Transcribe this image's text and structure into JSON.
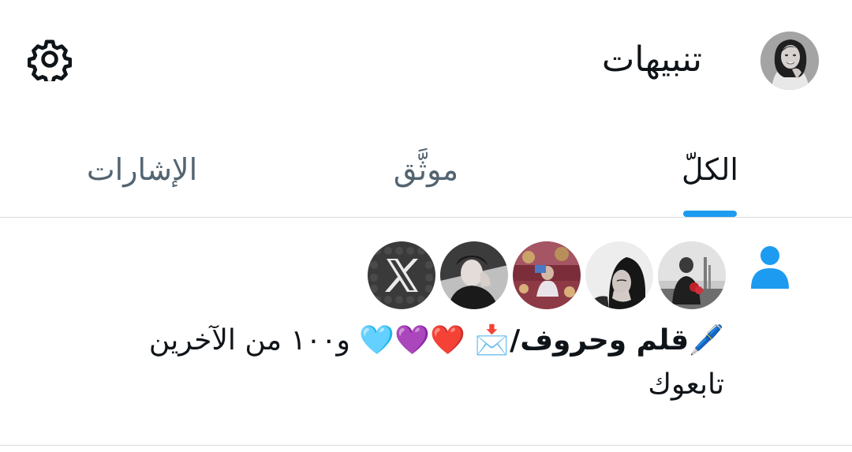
{
  "header": {
    "title": "تنبيهات",
    "settings_icon": "gear-icon",
    "avatar_icon": "profile-avatar"
  },
  "tabs": [
    {
      "label": "الكلّ",
      "active": true
    },
    {
      "label": "موثَّق",
      "active": false
    },
    {
      "label": "الإشارات",
      "active": false
    }
  ],
  "notification": {
    "type_icon": "person-follow-icon",
    "avatars": [
      "user-avatar-1",
      "user-avatar-2",
      "user-avatar-3",
      "user-avatar-4",
      "x-logo-avatar"
    ],
    "name": "🖊️قلم وحروف/📩",
    "hearts": "❤️💜🩵",
    "others": " و١٠٠ من الآخرين",
    "action": "تابعوك"
  },
  "colors": {
    "accent": "#1d9bf0",
    "text_primary": "#0f1419",
    "text_secondary": "#536471",
    "divider": "#d9dee2"
  }
}
